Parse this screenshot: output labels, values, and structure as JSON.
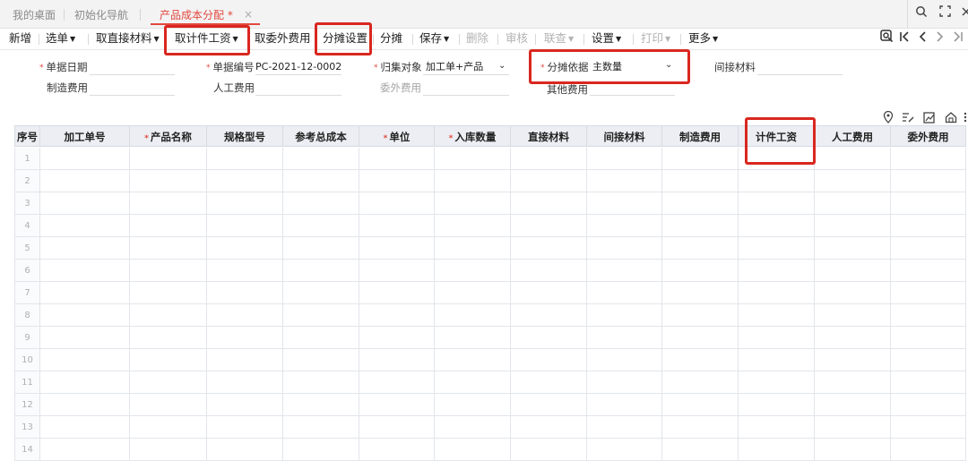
{
  "tabs": [
    {
      "label": "我的桌面",
      "active": false
    },
    {
      "label": "初始化导航",
      "active": false
    },
    {
      "label": "产品成本分配 *",
      "active": true
    }
  ],
  "tab_close_glyph": "×",
  "window_controls": [
    "search-icon",
    "fullscreen-icon",
    "close-icon"
  ],
  "toolbar": {
    "new": "新增",
    "select_bill": "选单",
    "get_direct_material": "取直接材料",
    "get_piece_wage": "取计件工资",
    "get_outsource_fee": "取委外费用",
    "allocation_settings": "分摊设置",
    "allocate": "分摊",
    "save": "保存",
    "delete": "删除",
    "audit": "审核",
    "query": "联查",
    "settings": "设置",
    "print": "打印",
    "more": "更多"
  },
  "form": {
    "doc_date_label": "单据日期",
    "doc_date_value": "",
    "doc_no_label": "单据编号",
    "doc_no_value": "PC-2021-12-0002",
    "collect_target_label": "归集对象",
    "collect_target_value": "加工单+产品",
    "allocation_basis_label": "分摊依据",
    "allocation_basis_value": "主数量",
    "indirect_material_label": "间接材料",
    "manufacturing_fee_label": "制造费用",
    "labor_fee_label": "人工费用",
    "outsource_fee_label": "委外费用",
    "other_fee_label": "其他费用"
  },
  "table": {
    "columns": [
      {
        "label": "序号",
        "required": false
      },
      {
        "label": "加工单号",
        "required": false
      },
      {
        "label": "产品名称",
        "required": true
      },
      {
        "label": "规格型号",
        "required": false
      },
      {
        "label": "参考总成本",
        "required": false
      },
      {
        "label": "单位",
        "required": true
      },
      {
        "label": "入库数量",
        "required": true
      },
      {
        "label": "直接材料",
        "required": false
      },
      {
        "label": "间接材料",
        "required": false
      },
      {
        "label": "制造费用",
        "required": false
      },
      {
        "label": "计件工资",
        "required": false
      },
      {
        "label": "人工费用",
        "required": false
      },
      {
        "label": "委外费用",
        "required": false
      }
    ],
    "row_numbers": [
      "1",
      "2",
      "3",
      "4",
      "5",
      "6",
      "7",
      "8",
      "9",
      "10",
      "11",
      "12",
      "13",
      "14"
    ]
  },
  "colors": {
    "accent": "#e2483d",
    "annotation": "#d9271f",
    "header_bg": "#eceef3"
  }
}
